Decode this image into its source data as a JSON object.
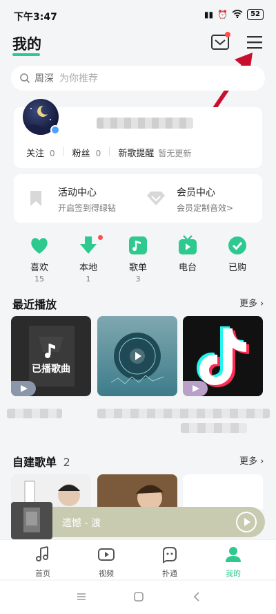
{
  "status_bar": {
    "time": "下午3:47",
    "battery": "52"
  },
  "header": {
    "title": "我的"
  },
  "search": {
    "keyword": "周深",
    "placeholder": "为你推荐"
  },
  "profile": {
    "follow_label": "关注",
    "follow_count": "0",
    "fans_label": "粉丝",
    "fans_count": "0",
    "new_songs_label": "新歌提醒",
    "new_songs_status": "暂无更新"
  },
  "activity": {
    "left": {
      "title": "活动中心",
      "subtitle": "开启签到得绿钻"
    },
    "right": {
      "title": "会员中心",
      "subtitle": "会员定制音效>"
    }
  },
  "quick": [
    {
      "label": "喜欢",
      "count": "15"
    },
    {
      "label": "本地",
      "count": "1"
    },
    {
      "label": "歌单",
      "count": "3"
    },
    {
      "label": "电台",
      "count": ""
    },
    {
      "label": "已购",
      "count": ""
    }
  ],
  "recent": {
    "title": "最近播放",
    "more": "更多",
    "cover1_text": "已播歌曲"
  },
  "playlists": {
    "title": "自建歌单",
    "count": "2",
    "more": "更多"
  },
  "now_playing": {
    "title": "遗憾 - 渡"
  },
  "bottom_nav": [
    {
      "label": "首页"
    },
    {
      "label": "视频"
    },
    {
      "label": "扑通"
    },
    {
      "label": "我的"
    }
  ],
  "colors": {
    "accent": "#2dc98e",
    "badge": "#ff4d4f",
    "arrow": "#c8102e"
  }
}
